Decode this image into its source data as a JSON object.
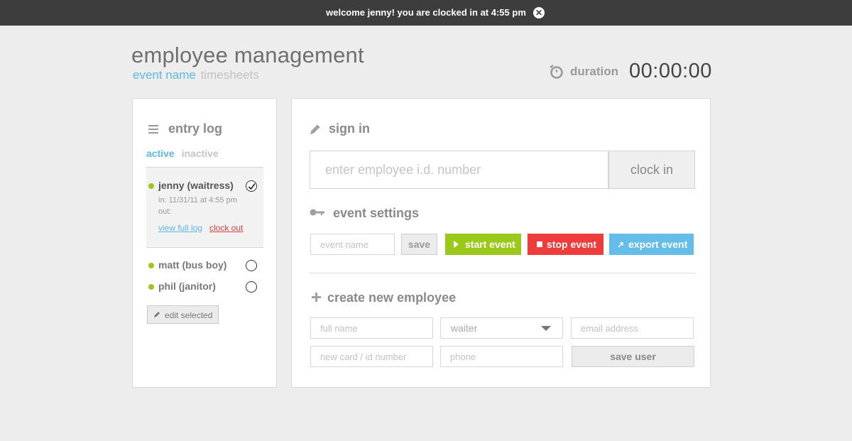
{
  "notification": {
    "message": "welcome jenny! you are clocked in at 4:55 pm",
    "close_icon": "close-icon"
  },
  "header": {
    "title": "employee management",
    "nav": {
      "active": "event name",
      "inactive": "timesheets"
    },
    "duration_label": "duration",
    "duration_value": "00:00:00"
  },
  "entry_log": {
    "title": "entry log",
    "tab_active": "active",
    "tab_inactive": "inactive",
    "employees": [
      {
        "name": "jenny (waitress)",
        "selected": true,
        "in": "in: 11/31/11 at 4:55 pm",
        "out": "out:",
        "view_link": "view full log",
        "clockout_link": "clock out"
      },
      {
        "name": "matt (bus boy)",
        "selected": false
      },
      {
        "name": "phil (janitor)",
        "selected": false
      }
    ],
    "edit_button": "edit selected"
  },
  "sign_in": {
    "title": "sign in",
    "placeholder": "enter employee i.d. number",
    "button": "clock in"
  },
  "event_settings": {
    "title": "event settings",
    "name_placeholder": "event name",
    "save": "save",
    "start": "start event",
    "stop": "stop event",
    "export": "export event"
  },
  "create_employee": {
    "title": "create new employee",
    "full_name_placeholder": "full name",
    "role_value": "waiter",
    "email_placeholder": "email address",
    "card_placeholder": "new card / id number",
    "phone_placeholder": "phone",
    "save": "save user"
  },
  "colors": {
    "accent_blue": "#5fb8e4",
    "start_green": "#9ac91b",
    "stop_red": "#ee3b3b",
    "export_blue": "#64bde9"
  }
}
